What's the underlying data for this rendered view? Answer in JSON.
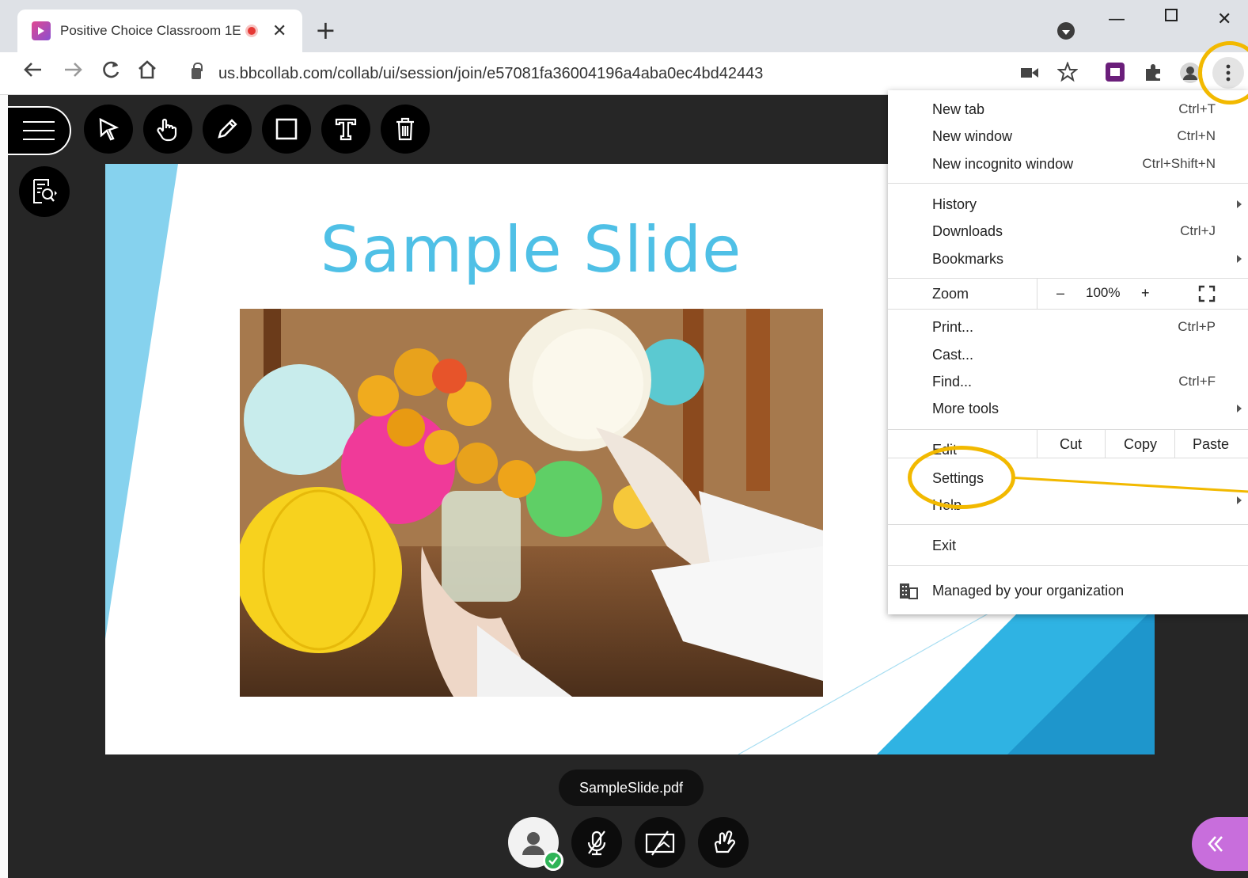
{
  "browser": {
    "tab_title": "Positive Choice Classroom 1E",
    "url": "us.bbcollab.com/collab/ui/session/join/e57081fa36004196a4aba0ec4bd42443"
  },
  "slide": {
    "title": "Sample Slide",
    "filename": "SampleSlide.pdf"
  },
  "chrome_menu": {
    "new_tab": {
      "label": "New tab",
      "shortcut": "Ctrl+T"
    },
    "new_window": {
      "label": "New window",
      "shortcut": "Ctrl+N"
    },
    "new_incognito": {
      "label": "New incognito window",
      "shortcut": "Ctrl+Shift+N"
    },
    "history": {
      "label": "History"
    },
    "downloads": {
      "label": "Downloads",
      "shortcut": "Ctrl+J"
    },
    "bookmarks": {
      "label": "Bookmarks"
    },
    "zoom": {
      "label": "Zoom",
      "minus": "–",
      "value": "100%",
      "plus": "+"
    },
    "print": {
      "label": "Print...",
      "shortcut": "Ctrl+P"
    },
    "cast": {
      "label": "Cast..."
    },
    "find": {
      "label": "Find...",
      "shortcut": "Ctrl+F"
    },
    "more_tools": {
      "label": "More tools"
    },
    "edit": {
      "label": "Edit",
      "cut": "Cut",
      "copy": "Copy",
      "paste": "Paste"
    },
    "settings": {
      "label": "Settings"
    },
    "help": {
      "label": "Help"
    },
    "exit": {
      "label": "Exit"
    },
    "managed": {
      "label": "Managed by your organization"
    }
  },
  "colors": {
    "highlight": "#f2b900",
    "slide_title": "#4fc0e6",
    "collab_panel": "#c86edc"
  }
}
